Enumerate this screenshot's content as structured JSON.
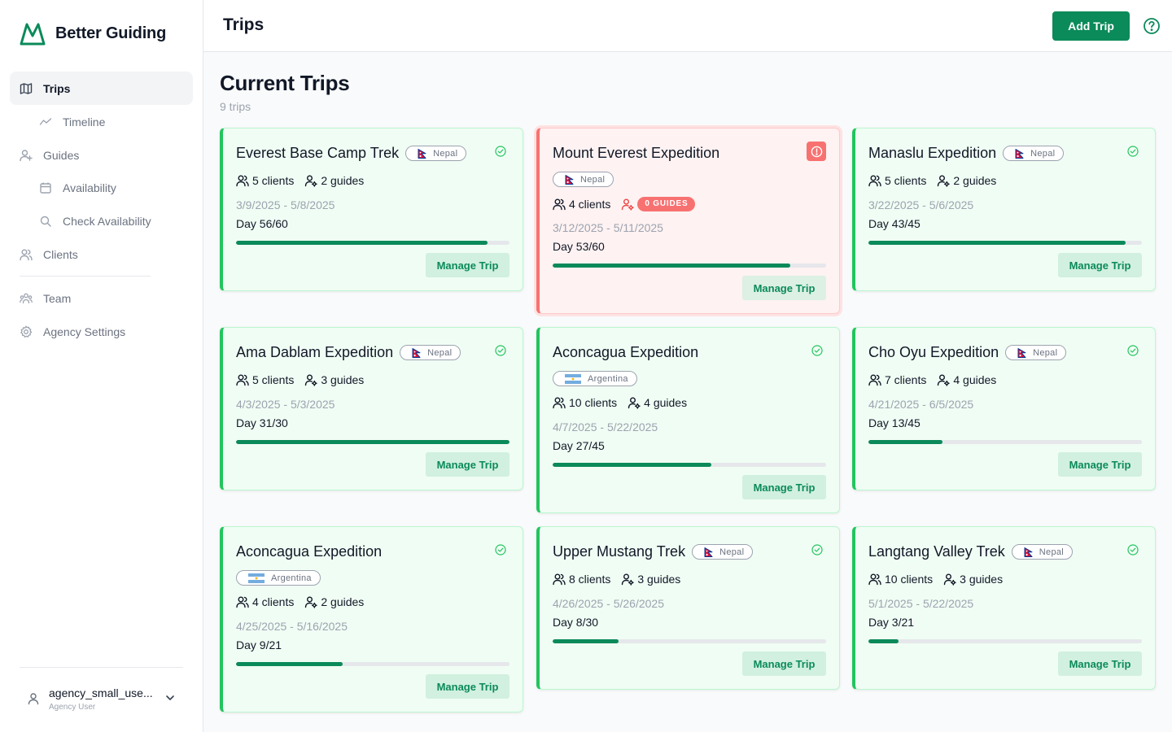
{
  "app": {
    "name": "Better Guiding"
  },
  "sidebar": {
    "items": [
      {
        "label": "Trips",
        "icon": "map-icon",
        "active": true
      },
      {
        "label": "Timeline",
        "icon": "trend-icon"
      },
      {
        "label": "Guides",
        "icon": "user-plus-icon"
      },
      {
        "label": "Availability",
        "icon": "calendar-icon"
      },
      {
        "label": "Check Availability",
        "icon": "search-icon"
      },
      {
        "label": "Clients",
        "icon": "users-icon"
      },
      {
        "label": "Team",
        "icon": "team-icon"
      },
      {
        "label": "Agency Settings",
        "icon": "gear-icon"
      }
    ],
    "user": {
      "name": "agency_small_use...",
      "role": "Agency User"
    }
  },
  "header": {
    "title": "Trips",
    "add_button": "Add Trip"
  },
  "main": {
    "section_title": "Current Trips",
    "trip_count": "9 trips",
    "manage_label": "Manage Trip",
    "zero_guides_label": "0 GUIDES",
    "trips": [
      {
        "title": "Everest Base Camp Trek",
        "country": "Nepal",
        "clients": "5 clients",
        "guides": "2 guides",
        "dates": "3/9/2025 - 5/8/2025",
        "day": "Day 56/60",
        "progress": 0.92,
        "status": "ok"
      },
      {
        "title": "Mount Everest Expedition",
        "country": "Nepal",
        "clients": "4 clients",
        "guides": "0 GUIDES",
        "dates": "3/12/2025 - 5/11/2025",
        "day": "Day 53/60",
        "progress": 0.87,
        "status": "alert"
      },
      {
        "title": "Manaslu Expedition",
        "country": "Nepal",
        "clients": "5 clients",
        "guides": "2 guides",
        "dates": "3/22/2025 - 5/6/2025",
        "day": "Day 43/45",
        "progress": 0.94,
        "status": "ok"
      },
      {
        "title": "Ama Dablam Expedition",
        "country": "Nepal",
        "clients": "5 clients",
        "guides": "3 guides",
        "dates": "4/3/2025 - 5/3/2025",
        "day": "Day 31/30",
        "progress": 1.0,
        "status": "ok"
      },
      {
        "title": "Aconcagua Expedition",
        "country": "Argentina",
        "clients": "10 clients",
        "guides": "4 guides",
        "dates": "4/7/2025 - 5/22/2025",
        "day": "Day 27/45",
        "progress": 0.58,
        "status": "ok"
      },
      {
        "title": "Cho Oyu Expedition",
        "country": "Nepal",
        "clients": "7 clients",
        "guides": "4 guides",
        "dates": "4/21/2025 - 6/5/2025",
        "day": "Day 13/45",
        "progress": 0.27,
        "status": "ok"
      },
      {
        "title": "Aconcagua Expedition",
        "country": "Argentina",
        "clients": "4 clients",
        "guides": "2 guides",
        "dates": "4/25/2025 - 5/16/2025",
        "day": "Day 9/21",
        "progress": 0.39,
        "status": "ok"
      },
      {
        "title": "Upper Mustang Trek",
        "country": "Nepal",
        "clients": "8 clients",
        "guides": "3 guides",
        "dates": "4/26/2025 - 5/26/2025",
        "day": "Day 8/30",
        "progress": 0.24,
        "status": "ok"
      },
      {
        "title": "Langtang Valley Trek",
        "country": "Nepal",
        "clients": "10 clients",
        "guides": "3 guides",
        "dates": "5/1/2025 - 5/22/2025",
        "day": "Day 3/21",
        "progress": 0.11,
        "status": "ok"
      }
    ]
  },
  "colors": {
    "accent": "#0b8a5a",
    "ok_bg": "#f0fdf4",
    "ok_border": "#22c55e",
    "alert_bg": "#fef2f2",
    "alert_border": "#f87171"
  }
}
